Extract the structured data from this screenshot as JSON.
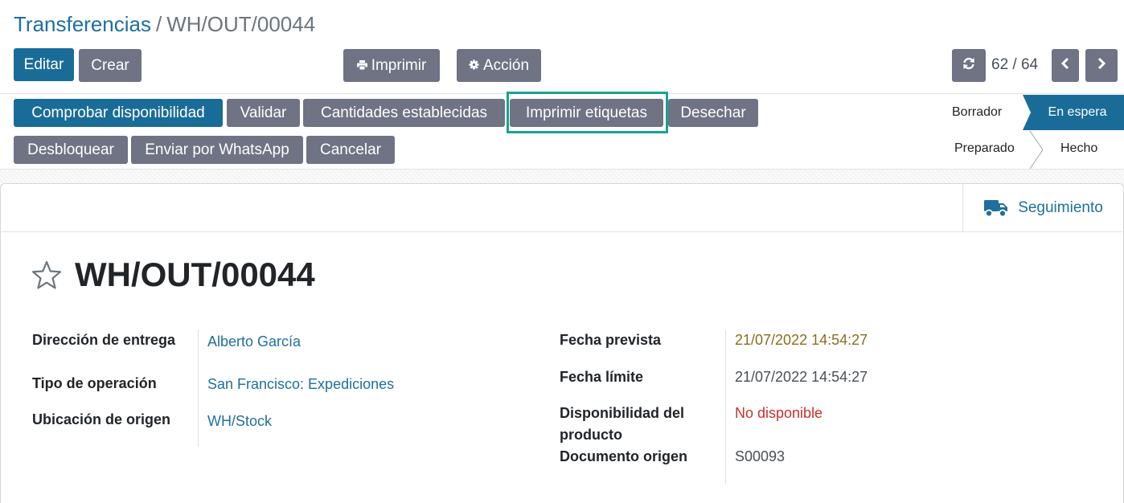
{
  "breadcrumb": {
    "parent": "Transferencias",
    "separator": "/",
    "current": "WH/OUT/00044"
  },
  "toolbar": {
    "edit": "Editar",
    "create": "Crear",
    "print": "Imprimir",
    "action": "Acción"
  },
  "pager": {
    "value": "62 / 64"
  },
  "actions": {
    "check_availability": "Comprobar disponibilidad",
    "validate": "Validar",
    "set_quantities": "Cantidades establecidas",
    "print_labels": "Imprimir etiquetas",
    "scrap": "Desechar",
    "unlock": "Desbloquear",
    "whatsapp": "Enviar por WhatsApp",
    "cancel": "Cancelar"
  },
  "statusbar": {
    "draft": "Borrador",
    "waiting": "En espera",
    "ready": "Preparado",
    "done": "Hecho"
  },
  "smart_button": {
    "label": "Seguimiento",
    "icon": "truck-icon"
  },
  "record": {
    "name": "WH/OUT/00044",
    "fields_left": [
      {
        "label": "Dirección de entrega",
        "value": "Alberto García"
      },
      {
        "label": "Tipo de operación",
        "value": "San Francisco: Expediciones"
      },
      {
        "label": "Ubicación de origen",
        "value": "WH/Stock"
      }
    ],
    "fields_right": [
      {
        "label": "Fecha prevista",
        "value": "21/07/2022 14:54:27"
      },
      {
        "label": "Fecha límite",
        "value": "21/07/2022 14:54:27"
      },
      {
        "label": "Disponibilidad del producto",
        "value": "No disponible"
      },
      {
        "label": "Documento origen",
        "value": "S00093"
      }
    ]
  },
  "colors": {
    "primary": "#1a6c98",
    "secondary": "#6f7384",
    "link": "#1f6f9f",
    "highlight": "#1aa195",
    "scheduled_date": "#8a6d1e",
    "unavailable": "#c9302c"
  }
}
